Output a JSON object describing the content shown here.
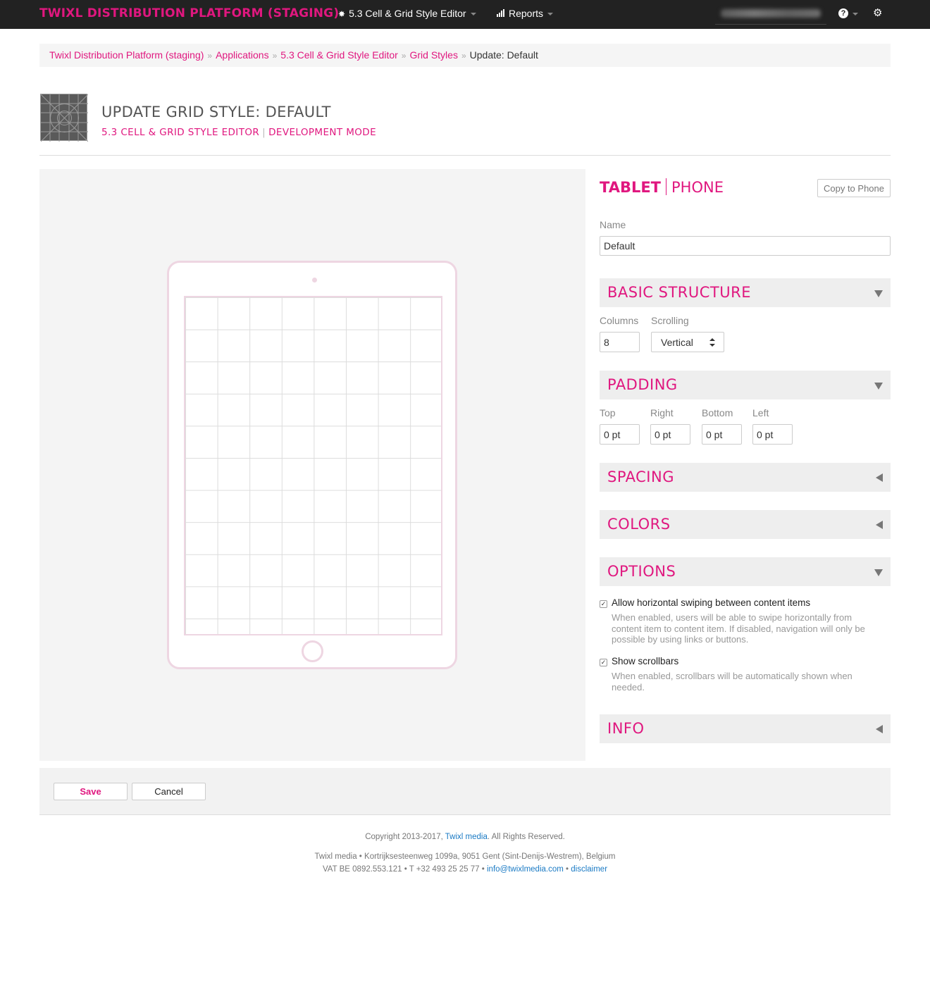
{
  "navbar": {
    "brand": "TWIXL DISTRIBUTION PLATFORM (STAGING)",
    "app_menu_label": "5.3 Cell & Grid Style Editor",
    "reports_label": "Reports",
    "icons": [
      "gear-icon",
      "bar-chart-icon",
      "help-icon",
      "settings-icon"
    ]
  },
  "breadcrumb": {
    "items": [
      "Twixl Distribution Platform (staging)",
      "Applications",
      "5.3 Cell & Grid Style Editor",
      "Grid Styles"
    ],
    "separator": "»",
    "current": "Update: Default"
  },
  "header": {
    "title": "UPDATE GRID STYLE: DEFAULT",
    "subtitle_app": "5.3 CELL & GRID STYLE EDITOR",
    "subtitle_mode": "DEVELOPMENT MODE"
  },
  "device_tabs": {
    "tablet": "TABLET",
    "phone": "PHONE"
  },
  "copy_button": "Copy to Phone",
  "name": {
    "label": "Name",
    "value": "Default"
  },
  "basic_structure": {
    "title": "BASIC STRUCTURE",
    "columns_label": "Columns",
    "columns_value": "8",
    "scrolling_label": "Scrolling",
    "scrolling_value": "Vertical"
  },
  "padding": {
    "title": "PADDING",
    "top_label": "Top",
    "top_value": "0 pt",
    "right_label": "Right",
    "right_value": "0 pt",
    "bottom_label": "Bottom",
    "bottom_value": "0 pt",
    "left_label": "Left",
    "left_value": "0 pt"
  },
  "spacing": {
    "title": "SPACING"
  },
  "colors": {
    "title": "COLORS"
  },
  "options": {
    "title": "OPTIONS",
    "swipe_label": "Allow horizontal swiping between content items",
    "swipe_help": "When enabled, users will be able to swipe horizontally from content item to content item. If disabled, navigation will only be possible by using links or buttons.",
    "swipe_checked": true,
    "scrollbars_label": "Show scrollbars",
    "scrollbars_help": "When enabled, scrollbars will be automatically shown when needed.",
    "scrollbars_checked": true
  },
  "info": {
    "title": "INFO"
  },
  "actions": {
    "save": "Save",
    "cancel": "Cancel"
  },
  "footer": {
    "copyright_prefix": "Copyright 2013-2017,",
    "company_link": "Twixl media",
    "copyright_suffix": ". All Rights Reserved.",
    "address": "Twixl media • Kortrijksesteenweg 1099a, 9051 Gent (Sint-Denijs-Westrem), Belgium",
    "vat_phone": "VAT BE 0892.553.121 • T +32 493 25 25 77 •",
    "email_link": "info@twixlmedia.com",
    "bullet": "•",
    "disclaimer_link": "disclaimer"
  },
  "colors_theme": {
    "accent": "#e0177f",
    "navbar": "#222222",
    "link": "#1a7ac4"
  }
}
